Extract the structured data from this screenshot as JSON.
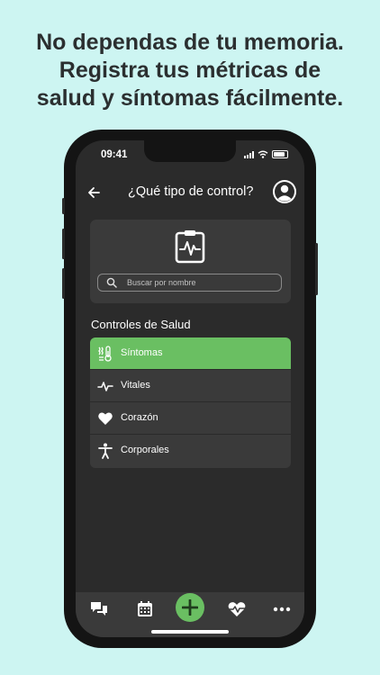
{
  "headline": {
    "line1": "No dependas de tu memoria.",
    "line2": "Registra tus métricas de",
    "line3": "salud y síntomas fácilmente."
  },
  "status": {
    "time": "09:41"
  },
  "header": {
    "title": "¿Qué tipo de control?"
  },
  "search": {
    "placeholder": "Buscar por nombre"
  },
  "section": {
    "title": "Controles de Salud"
  },
  "controls": [
    {
      "label": "Síntomas",
      "icon": "thermometer-icon",
      "selected": true
    },
    {
      "label": "Vitales",
      "icon": "vitals-pulse-icon",
      "selected": false
    },
    {
      "label": "Corazón",
      "icon": "heart-icon",
      "selected": false
    },
    {
      "label": "Corporales",
      "icon": "body-icon",
      "selected": false
    }
  ],
  "bottom_nav": [
    "chat-icon",
    "calendar-icon",
    "add-icon",
    "heart-pulse-icon",
    "more-icon"
  ],
  "colors": {
    "accent": "#6abf62",
    "background": "#cdf5f2",
    "surface": "#3a3a3a",
    "screen": "#2b2b2b"
  }
}
